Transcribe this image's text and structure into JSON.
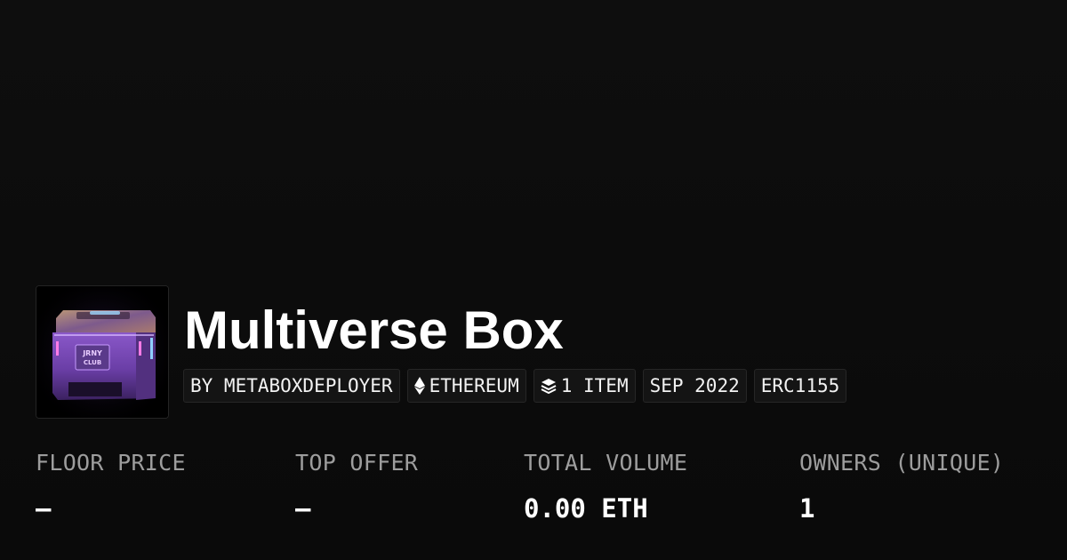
{
  "collection": {
    "name": "Multiverse Box",
    "thumbnail_text": "JRNY CLUB",
    "chips": {
      "creator": "BY METABOXDEPLOYER",
      "chain": "ETHEREUM",
      "chain_icon": "ethereum-icon",
      "items": "1 ITEM",
      "items_icon": "layers-icon",
      "date": "SEP 2022",
      "standard": "ERC1155"
    }
  },
  "stats": [
    {
      "label": "FLOOR PRICE",
      "value": "—"
    },
    {
      "label": "TOP OFFER",
      "value": "—"
    },
    {
      "label": "TOTAL VOLUME",
      "value": "0.00 ETH"
    },
    {
      "label": "OWNERS (UNIQUE)",
      "value": "1"
    }
  ],
  "colors": {
    "background": "#0b0b0b",
    "accent_purple": "#a066e8",
    "text_primary": "#ffffff",
    "text_muted": "#9d9d9d"
  }
}
